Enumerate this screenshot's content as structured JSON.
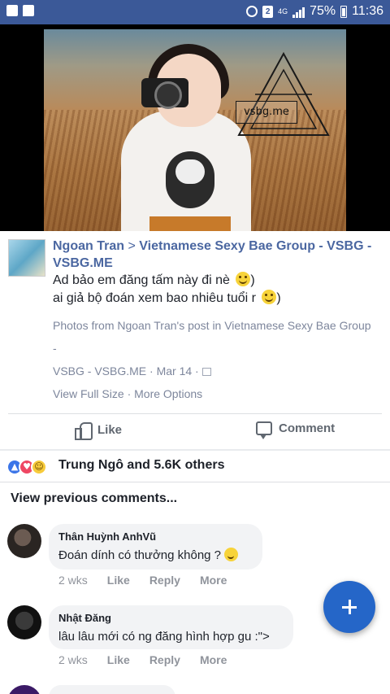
{
  "status_bar": {
    "battery": "75%",
    "time": "11:36",
    "sim_slot": "2",
    "network": "4G",
    "icons": [
      "gallery-icon",
      "message-icon",
      "alarm-icon",
      "sim-icon",
      "signal-icon",
      "battery-icon"
    ],
    "background_color": "#3b5998"
  },
  "photo": {
    "watermark_text": "vsbg.me"
  },
  "post": {
    "author": "Ngoan Tran",
    "separator": ">",
    "group": "Vietnamese Sexy Bae Group - VSBG - VSBG.ME",
    "text_line_1": "Ad bảo em đăng tấm này đi nè",
    "text_line_1_end": ")",
    "text_line_2": "ai giả bộ đoán xem bao nhiêu tuổi r",
    "text_line_2_end": ")",
    "meta_line_1": "Photos from Ngoan Tran's post in Vietnamese Sexy Bae Group -",
    "meta_line_2": "VSBG - VSBG.ME · Mar 14 ·",
    "view_full_size": "View Full Size",
    "meta_dot": "·",
    "more_options": "More Options",
    "link_color": "#4b67a1"
  },
  "actions": {
    "like_label": "Like",
    "comment_label": "Comment"
  },
  "reactions": {
    "types": [
      "like",
      "love",
      "haha"
    ],
    "summary": "Trung Ngô and 5.6K others"
  },
  "comments_section": {
    "view_previous": "View previous comments..."
  },
  "comments": [
    {
      "name": "Thân Huỳnh AnhVũ",
      "text": "Đoán dính có thưởng không ?",
      "time": "2 wks",
      "like": "Like",
      "reply": "Reply",
      "more": "More"
    },
    {
      "name": "Nhật Đăng",
      "text": "lâu lâu mới có ng đăng hình hợp gu :\">",
      "time": "2 wks",
      "like": "Like",
      "reply": "Reply",
      "more": "More"
    }
  ],
  "fab": {
    "icon": "plus-icon",
    "color": "#2566c8"
  }
}
